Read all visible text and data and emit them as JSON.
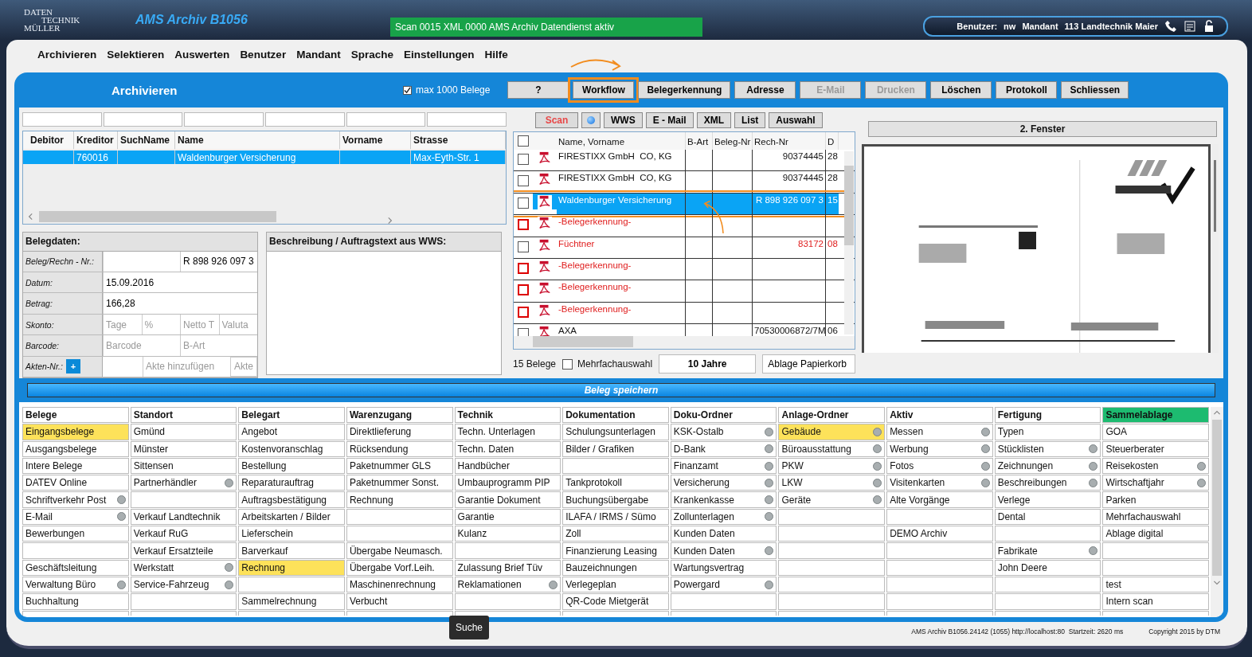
{
  "app": {
    "logo_lines": [
      "DATEN",
      "TECHNIK",
      "MÜLLER"
    ],
    "title": "AMS Archiv B1056",
    "status": "Scan 0015 XML 0000 AMS Archiv Datendienst aktiv",
    "user_label": "Benutzer:",
    "user": "nw",
    "mandant_label": "Mandant",
    "mandant": "113 Landtechnik Maier"
  },
  "menu": [
    "Archivieren",
    "Selektieren",
    "Auswerten",
    "Benutzer",
    "Mandant",
    "Sprache",
    "Einstellungen",
    "Hilfe"
  ],
  "panel": {
    "title": "Archivieren",
    "max_checkbox": {
      "label": "max 1000 Belege",
      "checked": true
    }
  },
  "toolbar": [
    {
      "label": "?",
      "disabled": false,
      "annotated": false
    },
    {
      "label": "Workflow",
      "disabled": false,
      "annotated": true
    },
    {
      "label": "Belegerkennung",
      "disabled": false,
      "annotated": false
    },
    {
      "label": "Adresse",
      "disabled": false,
      "annotated": false
    },
    {
      "label": "E-Mail",
      "disabled": true,
      "annotated": false
    },
    {
      "label": "Drucken",
      "disabled": true,
      "annotated": false
    },
    {
      "label": "Löschen",
      "disabled": false,
      "annotated": false
    },
    {
      "label": "Protokoll",
      "disabled": false,
      "annotated": false
    },
    {
      "label": "Schliessen",
      "disabled": false,
      "annotated": false
    }
  ],
  "address_table": {
    "columns": [
      "Debitor",
      "Kreditor",
      "SuchName",
      "Name",
      "Vorname",
      "Strasse"
    ],
    "rows": [
      {
        "selected": true,
        "cells": [
          "",
          "760016",
          "",
          "Waldenburger Versicherung",
          "",
          "Max-Eyth-Str. 1"
        ]
      }
    ]
  },
  "belegdaten": {
    "title": "Belegdaten:",
    "rows": [
      {
        "label": "Beleg/Rechn - Nr.:",
        "inputs": [
          {
            "kind": "field"
          },
          {
            "kind": "field",
            "value": "R 898 926 097 3"
          }
        ]
      },
      {
        "label": "Datum:",
        "inputs": [
          {
            "kind": "field",
            "value": "15.09.2016"
          }
        ]
      },
      {
        "label": "Betrag:",
        "inputs": [
          {
            "kind": "field",
            "value": "166,28"
          }
        ]
      },
      {
        "label": "Skonto:",
        "inputs": [
          {
            "kind": "field",
            "placeholder": "Tage"
          },
          {
            "kind": "field",
            "placeholder": "%"
          },
          {
            "kind": "field",
            "placeholder": "Netto T"
          },
          {
            "kind": "field",
            "placeholder": "Valuta"
          }
        ]
      },
      {
        "label": "Barcode:",
        "inputs": [
          {
            "kind": "field",
            "placeholder": "Barcode"
          },
          {
            "kind": "field",
            "placeholder": "B-Art"
          }
        ]
      },
      {
        "label": "Akten-Nr.:",
        "add": "+",
        "inputs": [
          {
            "kind": "blank"
          },
          {
            "kind": "field",
            "placeholder": "Akte hinzufügen"
          },
          {
            "kind": "button",
            "label": "Akte",
            "disabled": true
          }
        ]
      }
    ]
  },
  "description": {
    "title": "Beschreibung / Auftragstext aus WWS:"
  },
  "doc_toolbar": [
    {
      "kind": "scan",
      "label": "Scan"
    },
    {
      "kind": "status"
    },
    {
      "kind": "button",
      "label": "WWS"
    },
    {
      "kind": "button",
      "label": "E - Mail"
    },
    {
      "kind": "button",
      "label": "XML"
    },
    {
      "kind": "button",
      "label": "List"
    },
    {
      "kind": "button",
      "label": "Auswahl"
    }
  ],
  "documents": {
    "all_checked": false,
    "columns": [
      "Name, Vorname",
      "B-Art",
      "Beleg-Nr",
      "Rech-Nr",
      "D"
    ],
    "rows": [
      {
        "checked": false,
        "flagged": false,
        "error": false,
        "selected": false,
        "annotated": false,
        "name": "FIRESTIXX GmbH  CO, KG",
        "rech_nr": "90374445",
        "date": "28"
      },
      {
        "checked": false,
        "flagged": false,
        "error": false,
        "selected": false,
        "annotated": false,
        "name": "FIRESTIXX GmbH  CO, KG",
        "rech_nr": "90374445",
        "date": "28"
      },
      {
        "checked": false,
        "flagged": false,
        "error": false,
        "selected": true,
        "annotated": true,
        "name": "Waldenburger Versicherung",
        "rech_nr": "R 898 926 097 3",
        "date": "15"
      },
      {
        "checked": false,
        "flagged": true,
        "error": true,
        "selected": false,
        "annotated": false,
        "name": "-Belegerkennung-"
      },
      {
        "checked": false,
        "flagged": false,
        "error": true,
        "selected": false,
        "annotated": false,
        "name": "Füchtner",
        "rech_nr": "83172",
        "date": "08"
      },
      {
        "checked": false,
        "flagged": true,
        "error": true,
        "selected": false,
        "annotated": false,
        "name": "-Belegerkennung-"
      },
      {
        "checked": false,
        "flagged": true,
        "error": true,
        "selected": false,
        "annotated": false,
        "name": "-Belegerkennung-"
      },
      {
        "checked": false,
        "flagged": true,
        "error": true,
        "selected": false,
        "annotated": false,
        "name": "-Belegerkennung-"
      },
      {
        "checked": false,
        "flagged": false,
        "error": false,
        "selected": false,
        "annotated": false,
        "name": "AXA",
        "rech_nr": "70530006872/7M",
        "date": "06"
      }
    ]
  },
  "list_footer": {
    "count": "15 Belege",
    "multi": {
      "label": "Mehrfachauswahl",
      "checked": false
    },
    "period": "10 Jahre",
    "trash": "Ablage Papierkorb"
  },
  "preview": {
    "title": "2. Fenster"
  },
  "save_bar": "Beleg speichern",
  "categories": [
    {
      "title": "Belege",
      "active": false,
      "cells": [
        {
          "text": "Eingangsbelege",
          "selected": true,
          "dot": false
        },
        {
          "text": "Ausgangsbelege",
          "selected": false,
          "dot": false
        },
        {
          "text": "Intere Belege",
          "selected": false,
          "dot": false
        },
        {
          "text": "DATEV Online",
          "selected": false,
          "dot": false
        },
        {
          "text": "Schriftverkehr Post",
          "selected": false,
          "dot": true
        },
        {
          "text": "E-Mail",
          "selected": false,
          "dot": true
        },
        {
          "text": "Bewerbungen",
          "selected": false,
          "dot": false
        },
        {
          "selected": false,
          "dot": false
        },
        {
          "text": "Geschäftsleitung",
          "selected": false,
          "dot": false
        },
        {
          "text": "Verwaltung Büro",
          "selected": false,
          "dot": true
        },
        {
          "text": "Buchhaltung",
          "selected": false,
          "dot": false
        }
      ]
    },
    {
      "title": "Standort",
      "active": false,
      "cells": [
        {
          "text": "Gmünd",
          "selected": false,
          "dot": false
        },
        {
          "text": "Münster",
          "selected": false,
          "dot": false
        },
        {
          "text": "Sittensen",
          "selected": false,
          "dot": false
        },
        {
          "text": "Partnerhändler",
          "selected": false,
          "dot": true
        },
        {
          "selected": false,
          "dot": false
        },
        {
          "text": "Verkauf Landtechnik",
          "selected": false,
          "dot": false
        },
        {
          "text": "Verkauf RuG",
          "selected": false,
          "dot": false
        },
        {
          "text": "Verkauf Ersatzteile",
          "selected": false,
          "dot": false
        },
        {
          "text": "Werkstatt",
          "selected": false,
          "dot": true
        },
        {
          "text": "Service-Fahrzeug",
          "selected": false,
          "dot": true
        },
        {
          "selected": false,
          "dot": false
        }
      ]
    },
    {
      "title": "Belegart",
      "active": false,
      "cells": [
        {
          "text": "Angebot",
          "selected": false,
          "dot": false
        },
        {
          "text": "Kostenvoranschlag",
          "selected": false,
          "dot": false
        },
        {
          "text": "Bestellung",
          "selected": false,
          "dot": false
        },
        {
          "text": "Reparaturauftrag",
          "selected": false,
          "dot": false
        },
        {
          "text": "Auftragsbestätigung",
          "selected": false,
          "dot": false
        },
        {
          "text": "Arbeitskarten / Bilder",
          "selected": false,
          "dot": false
        },
        {
          "text": "Lieferschein",
          "selected": false,
          "dot": false
        },
        {
          "text": "Barverkauf",
          "selected": false,
          "dot": false
        },
        {
          "text": "Rechnung",
          "selected": true,
          "dot": false
        },
        {
          "selected": false,
          "dot": false
        },
        {
          "text": "Sammelrechnung",
          "selected": false,
          "dot": false
        }
      ]
    },
    {
      "title": "Warenzugang",
      "active": false,
      "cells": [
        {
          "text": "Direktlieferung",
          "selected": false,
          "dot": false
        },
        {
          "text": "Rücksendung",
          "selected": false,
          "dot": false
        },
        {
          "text": "Paketnummer GLS",
          "selected": false,
          "dot": false
        },
        {
          "text": "Paketnummer Sonst.",
          "selected": false,
          "dot": false
        },
        {
          "text": "Rechnung",
          "selected": false,
          "dot": false
        },
        {
          "selected": false,
          "dot": false
        },
        {
          "selected": false,
          "dot": false
        },
        {
          "text": "Übergabe Neumasch.",
          "selected": false,
          "dot": false
        },
        {
          "text": "Übergabe Vorf.Leih.",
          "selected": false,
          "dot": false
        },
        {
          "text": "Maschinenrechnung",
          "selected": false,
          "dot": false
        },
        {
          "text": "Verbucht",
          "selected": false,
          "dot": false
        }
      ]
    },
    {
      "title": "Technik",
      "active": false,
      "cells": [
        {
          "text": "Techn. Unterlagen",
          "selected": false,
          "dot": false
        },
        {
          "text": "Techn. Daten",
          "selected": false,
          "dot": false
        },
        {
          "text": "Handbücher",
          "selected": false,
          "dot": false
        },
        {
          "text": "Umbauprogramm PIP",
          "selected": false,
          "dot": false
        },
        {
          "text": "Garantie Dokument",
          "selected": false,
          "dot": false
        },
        {
          "text": "Garantie",
          "selected": false,
          "dot": false
        },
        {
          "text": "Kulanz",
          "selected": false,
          "dot": false
        },
        {
          "selected": false,
          "dot": false
        },
        {
          "text": "Zulassung Brief Tüv",
          "selected": false,
          "dot": false
        },
        {
          "text": "Reklamationen",
          "selected": false,
          "dot": true
        },
        {
          "selected": false,
          "dot": false
        }
      ]
    },
    {
      "title": "Dokumentation",
      "active": false,
      "cells": [
        {
          "text": "Schulungsunterlagen",
          "selected": false,
          "dot": false
        },
        {
          "text": "Bilder / Grafiken",
          "selected": false,
          "dot": false
        },
        {
          "selected": false,
          "dot": false
        },
        {
          "text": "Tankprotokoll",
          "selected": false,
          "dot": false
        },
        {
          "text": "Buchungsübergabe",
          "selected": false,
          "dot": false
        },
        {
          "text": "ILAFA / IRMS / Sümo",
          "selected": false,
          "dot": false
        },
        {
          "text": "Zoll",
          "selected": false,
          "dot": false
        },
        {
          "text": "Finanzierung Leasing",
          "selected": false,
          "dot": false
        },
        {
          "text": "Bauzeichnungen",
          "selected": false,
          "dot": false
        },
        {
          "text": "Verlegeplan",
          "selected": false,
          "dot": false
        },
        {
          "text": "QR-Code Mietgerät",
          "selected": false,
          "dot": false
        }
      ]
    },
    {
      "title": "Doku-Ordner",
      "active": false,
      "cells": [
        {
          "text": "KSK-Ostalb",
          "selected": false,
          "dot": true
        },
        {
          "text": "D-Bank",
          "selected": false,
          "dot": true
        },
        {
          "text": "Finanzamt",
          "selected": false,
          "dot": true
        },
        {
          "text": "Versicherung",
          "selected": false,
          "dot": true
        },
        {
          "text": "Krankenkasse",
          "selected": false,
          "dot": true
        },
        {
          "text": "Zollunterlagen",
          "selected": false,
          "dot": true
        },
        {
          "text": "Kunden Daten",
          "selected": false,
          "dot": false
        },
        {
          "text": "Kunden Daten",
          "selected": false,
          "dot": true
        },
        {
          "text": "Wartungsvertrag",
          "selected": false,
          "dot": false
        },
        {
          "text": "Powergard",
          "selected": false,
          "dot": true
        },
        {
          "selected": false,
          "dot": false
        }
      ]
    },
    {
      "title": "Anlage-Ordner",
      "active": false,
      "cells": [
        {
          "text": "Gebäude",
          "selected": true,
          "dot": true
        },
        {
          "text": "Büroausstattung",
          "selected": false,
          "dot": true
        },
        {
          "text": "PKW",
          "selected": false,
          "dot": true
        },
        {
          "text": "LKW",
          "selected": false,
          "dot": true
        },
        {
          "text": "Geräte",
          "selected": false,
          "dot": true
        },
        {
          "selected": false,
          "dot": false
        },
        {
          "selected": false,
          "dot": false
        },
        {
          "selected": false,
          "dot": false
        },
        {
          "selected": false,
          "dot": false
        },
        {
          "selected": false,
          "dot": false
        },
        {
          "selected": false,
          "dot": false
        }
      ]
    },
    {
      "title": "Aktiv",
      "active": false,
      "cells": [
        {
          "text": "Messen",
          "selected": false,
          "dot": true
        },
        {
          "text": "Werbung",
          "selected": false,
          "dot": true
        },
        {
          "text": "Fotos",
          "selected": false,
          "dot": true
        },
        {
          "text": "Visitenkarten",
          "selected": false,
          "dot": true
        },
        {
          "text": "Alte Vorgänge",
          "selected": false,
          "dot": false
        },
        {
          "selected": false,
          "dot": false
        },
        {
          "text": "DEMO Archiv",
          "selected": false,
          "dot": false
        },
        {
          "selected": false,
          "dot": false
        },
        {
          "selected": false,
          "dot": false
        },
        {
          "selected": false,
          "dot": false
        },
        {
          "selected": false,
          "dot": false
        }
      ]
    },
    {
      "title": "Fertigung",
      "active": false,
      "cells": [
        {
          "text": "Typen",
          "selected": false,
          "dot": false
        },
        {
          "text": "Stücklisten",
          "selected": false,
          "dot": true
        },
        {
          "text": "Zeichnungen",
          "selected": false,
          "dot": true
        },
        {
          "text": "Beschreibungen",
          "selected": false,
          "dot": true
        },
        {
          "text": "Verlege",
          "selected": false,
          "dot": false
        },
        {
          "text": "Dental",
          "selected": false,
          "dot": false
        },
        {
          "selected": false,
          "dot": false
        },
        {
          "text": "Fabrikate",
          "selected": false,
          "dot": true
        },
        {
          "text": "John Deere",
          "selected": false,
          "dot": false
        },
        {
          "selected": false,
          "dot": false
        },
        {
          "selected": false,
          "dot": false
        }
      ]
    },
    {
      "title": "Sammelablage",
      "active": true,
      "cells": [
        {
          "text": "GOA",
          "selected": false,
          "dot": false
        },
        {
          "text": "Steuerberater",
          "selected": false,
          "dot": false
        },
        {
          "text": "Reisekosten",
          "selected": false,
          "dot": true
        },
        {
          "text": "Wirtschaftjahr",
          "selected": false,
          "dot": true
        },
        {
          "text": "Parken",
          "selected": false,
          "dot": false
        },
        {
          "text": "Mehrfachauswahl",
          "selected": false,
          "dot": false
        },
        {
          "text": "Ablage digital",
          "selected": false,
          "dot": false
        },
        {
          "selected": false,
          "dot": false
        },
        {
          "selected": false,
          "dot": false
        },
        {
          "text": "test",
          "selected": false,
          "dot": false
        },
        {
          "text": "Intern scan",
          "selected": false,
          "dot": false
        }
      ]
    }
  ],
  "search_button": "Suche",
  "status_bar": {
    "info": "AMS Archiv B1056.24142 (1055) http://localhost:80  Startzeit: 2620 ms",
    "copyright": "Copyright 2015 by DTM"
  }
}
